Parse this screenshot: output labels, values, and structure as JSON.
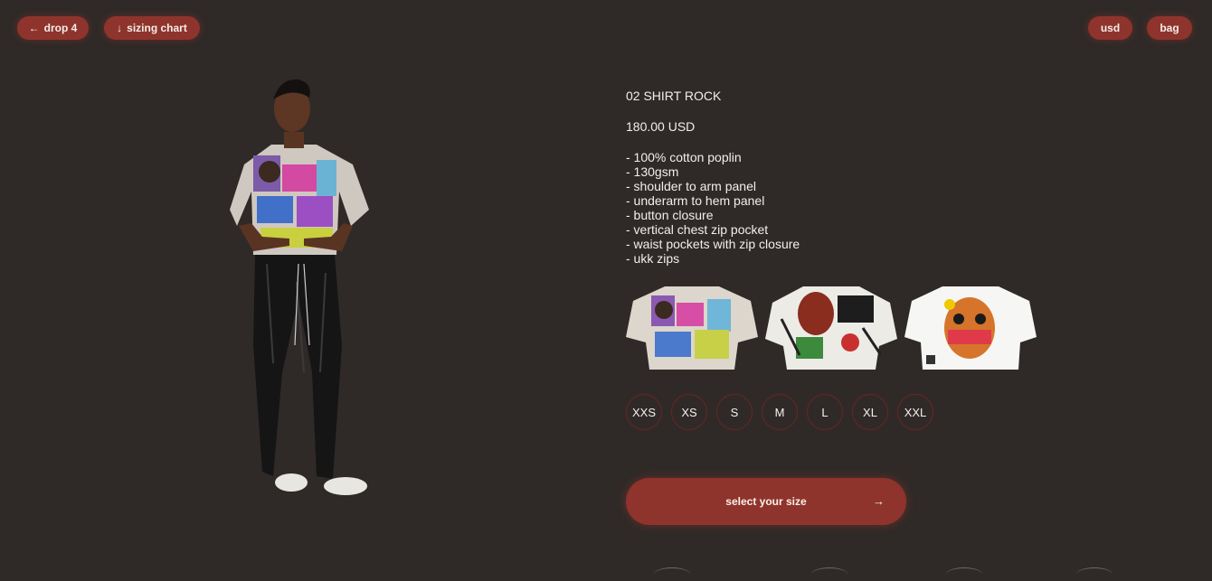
{
  "header": {
    "drop_label": "drop 4",
    "drop_icon": "arrow-left-icon",
    "sizing_label": "sizing chart",
    "sizing_icon": "arrow-down-icon",
    "currency_label": "usd",
    "bag_label": "bag"
  },
  "product": {
    "title": "02 SHIRT ROCK",
    "price": "180.00 USD",
    "features": [
      "- 100% cotton poplin",
      "- 130gsm",
      "- shoulder to arm panel",
      "- underarm to hem panel",
      "- button closure",
      "- vertical chest zip pocket",
      "- waist pockets with zip closure",
      "- ukk zips"
    ],
    "thumbnails": [
      "shirt-front-thumbnail",
      "shirt-back-thumbnail",
      "shirt-white-thumbnail"
    ]
  },
  "sizes": [
    "XXS",
    "XS",
    "S",
    "M",
    "L",
    "XL",
    "XXL"
  ],
  "cta": {
    "label": "select your size",
    "icon": "arrow-right-icon"
  },
  "colors": {
    "background": "#2f2a28",
    "accent": "#8e342c",
    "size_border": "#6a2520"
  }
}
